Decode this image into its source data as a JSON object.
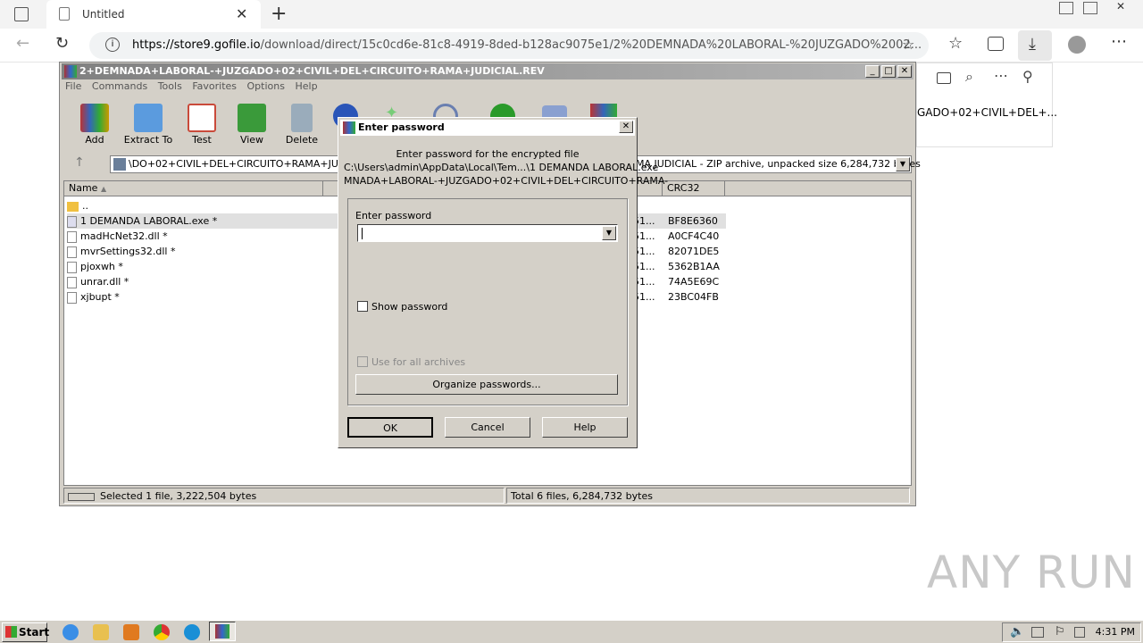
{
  "browser": {
    "tab_title": "Untitled",
    "url_host": "https://store9.gofile.io",
    "url_path": "/download/direct/15c0cd6e-81c8-4919-8ded-b128ac9075e1/2%20DEMNADA%20LABORAL-%20JUZGADO%2002...",
    "download_item": "GADO+02+CIVIL+DEL+..."
  },
  "winrar": {
    "title": "2+DEMNADA+LABORAL-+JUZGADO+02+CIVIL+DEL+CIRCUITO+RAMA+JUDICIAL.REV",
    "menu": [
      "File",
      "Commands",
      "Tools",
      "Favorites",
      "Options",
      "Help"
    ],
    "toolbar": [
      {
        "label": "Add",
        "color": "#c0392b"
      },
      {
        "label": "Extract To",
        "color": "#3d7fd6"
      },
      {
        "label": "Test",
        "color": "#c94a3a"
      },
      {
        "label": "View",
        "color": "#3a9a3a"
      },
      {
        "label": "Delete",
        "color": "#7a8fa0"
      }
    ],
    "path_text": "\\DO+02+CIVIL+DEL+CIRCUITO+RAMA+JUDIC",
    "path_suffix": "MA JUDICIAL - ZIP archive, unpacked size 6,284,732 bytes",
    "columns": {
      "name": "Name",
      "crc": "CRC32"
    },
    "files": [
      {
        "name": "..",
        "ext": "",
        "crc": ""
      },
      {
        "name": "1 DEMANDA LABORAL.exe *",
        "ext": "51...",
        "crc": "BF8E6360"
      },
      {
        "name": "madHcNet32.dll *",
        "ext": "51...",
        "crc": "A0CF4C40"
      },
      {
        "name": "mvrSettings32.dll *",
        "ext": "51...",
        "crc": "82071DE5"
      },
      {
        "name": "pjoxwh *",
        "ext": "51...",
        "crc": "5362B1AA"
      },
      {
        "name": "unrar.dll *",
        "ext": "51...",
        "crc": "74A5E69C"
      },
      {
        "name": "xjbupt *",
        "ext": "51...",
        "crc": "23BC04FB"
      }
    ],
    "status_left": "Selected 1 file, 3,222,504 bytes",
    "status_right": "Total 6 files, 6,284,732 bytes"
  },
  "dialog": {
    "title": "Enter password",
    "line1": "Enter password for the encrypted file",
    "line2": "C:\\Users\\admin\\AppData\\Local\\Tem...\\1 DEMANDA LABORAL.exe",
    "line3": "MNADA+LABORAL-+JUZGADO+02+CIVIL+DEL+CIRCUITO+RAMA-",
    "field_label": "Enter password",
    "password_value": "",
    "show_password": "Show password",
    "use_all": "Use for all archives",
    "organize": "Organize passwords...",
    "ok": "OK",
    "cancel": "Cancel",
    "help": "Help"
  },
  "taskbar": {
    "start": "Start",
    "clock": "4:31 PM"
  },
  "watermark": "ANY RUN"
}
